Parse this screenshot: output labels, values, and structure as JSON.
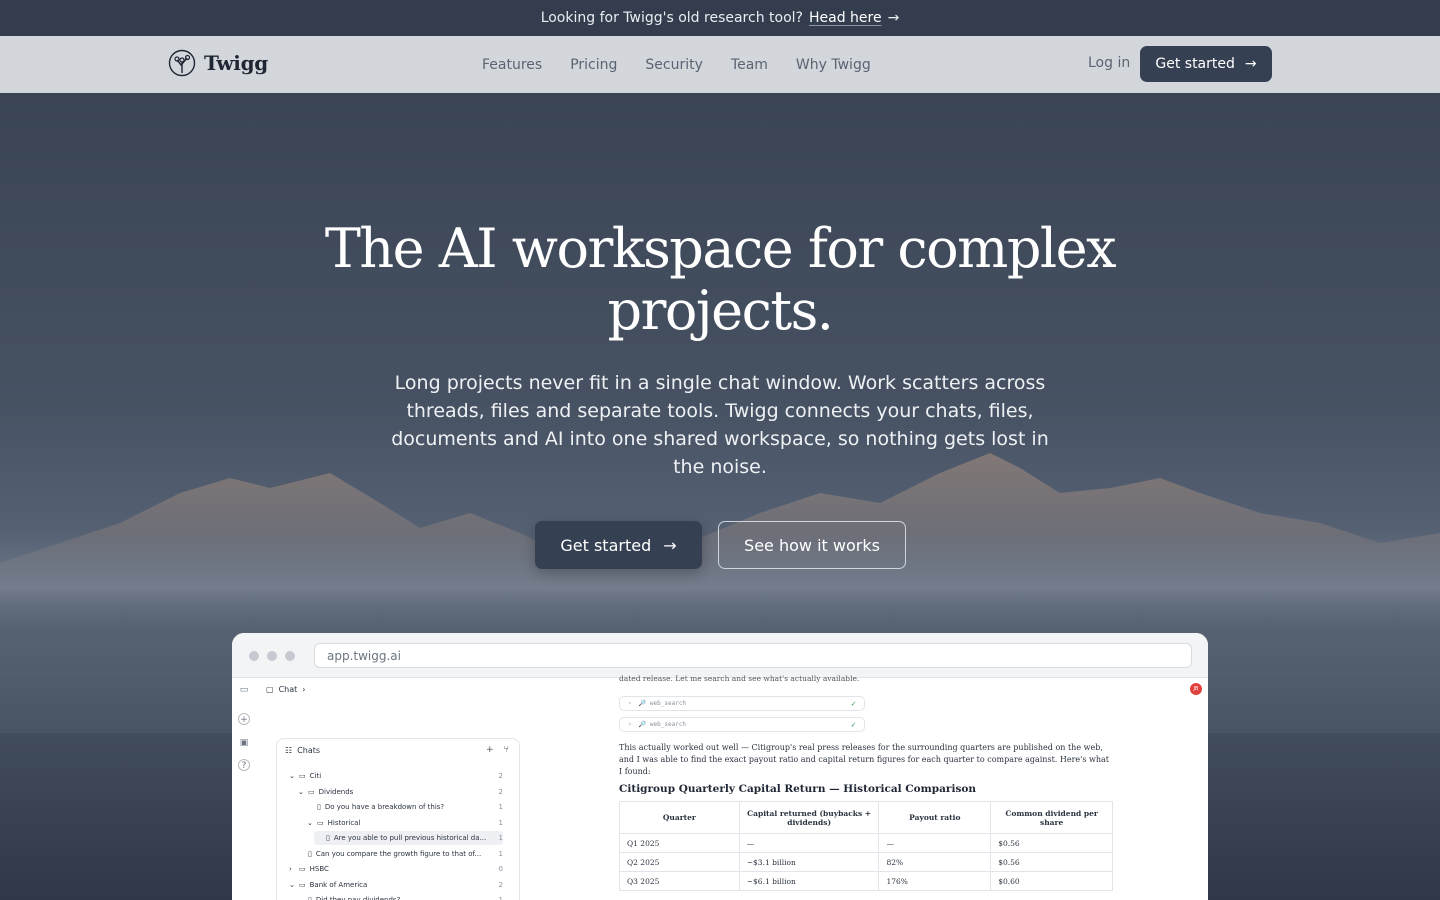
{
  "announcement": {
    "text": "Looking for Twigg's old research tool?",
    "link": "Head here",
    "arrow": "→"
  },
  "nav": {
    "brand": "Twigg",
    "links": [
      "Features",
      "Pricing",
      "Security",
      "Team",
      "Why Twigg"
    ],
    "login": "Log in",
    "cta": "Get started",
    "cta_arrow": "→"
  },
  "hero": {
    "title_line1": "The AI workspace for complex",
    "title_line2": "projects.",
    "subtitle": "Long projects never fit in a single chat window. Work scatters across threads, files and separate tools. Twigg connects your chats, files, documents and AI into one shared workspace, so nothing gets lost in the noise.",
    "primary": "Get started",
    "primary_arrow": "→",
    "secondary": "See how it works"
  },
  "app": {
    "url": "app.twigg.ai",
    "crumb": "Chat",
    "crumb_chevron": "›",
    "panel_title": "Chats",
    "avatar": "JB",
    "top_text": "dated release. Let me search and see what's actually available.",
    "tools": [
      "web_search",
      "web_search"
    ],
    "tool_check": "✓",
    "paragraph": "This actually worked out well — Citigroup's real press releases for the surrounding quarters are published on the web, and I was able to find the exact payout ratio and capital return figures for each quarter to compare against. Here's what I found:",
    "table_title": "Citigroup Quarterly Capital Return — Historical Comparison",
    "columns": [
      "Quarter",
      "Capital returned (buybacks + dividends)",
      "Payout ratio",
      "Common dividend per share"
    ],
    "rows": [
      [
        "Q1 2025",
        "—",
        "—",
        "$0.56"
      ],
      [
        "Q2 2025",
        "~$3.1 billion",
        "82%",
        "$0.56"
      ],
      [
        "Q3 2025",
        "~$6.1 billion",
        "176%",
        "$0.60"
      ]
    ],
    "tree": [
      {
        "label": "Citi",
        "count": "2",
        "depth": 0,
        "kind": "folder",
        "open": true
      },
      {
        "label": "Dividends",
        "count": "2",
        "depth": 1,
        "kind": "folder",
        "open": true
      },
      {
        "label": "Do you have a breakdown of this?",
        "count": "1",
        "depth": 2,
        "kind": "file"
      },
      {
        "label": "Historical",
        "count": "1",
        "depth": 2,
        "kind": "folder",
        "open": true
      },
      {
        "label": "Are you able to pull previous historical da...",
        "count": "1",
        "depth": 3,
        "kind": "file",
        "selected": true
      },
      {
        "label": "Can you compare the growth figure to that of...",
        "count": "1",
        "depth": 1,
        "kind": "file"
      },
      {
        "label": "HSBC",
        "count": "0",
        "depth": 0,
        "kind": "folder",
        "open": false
      },
      {
        "label": "Bank of America",
        "count": "2",
        "depth": 0,
        "kind": "folder",
        "open": true
      },
      {
        "label": "Did they pay dividends?",
        "count": "1",
        "depth": 1,
        "kind": "file"
      }
    ]
  }
}
